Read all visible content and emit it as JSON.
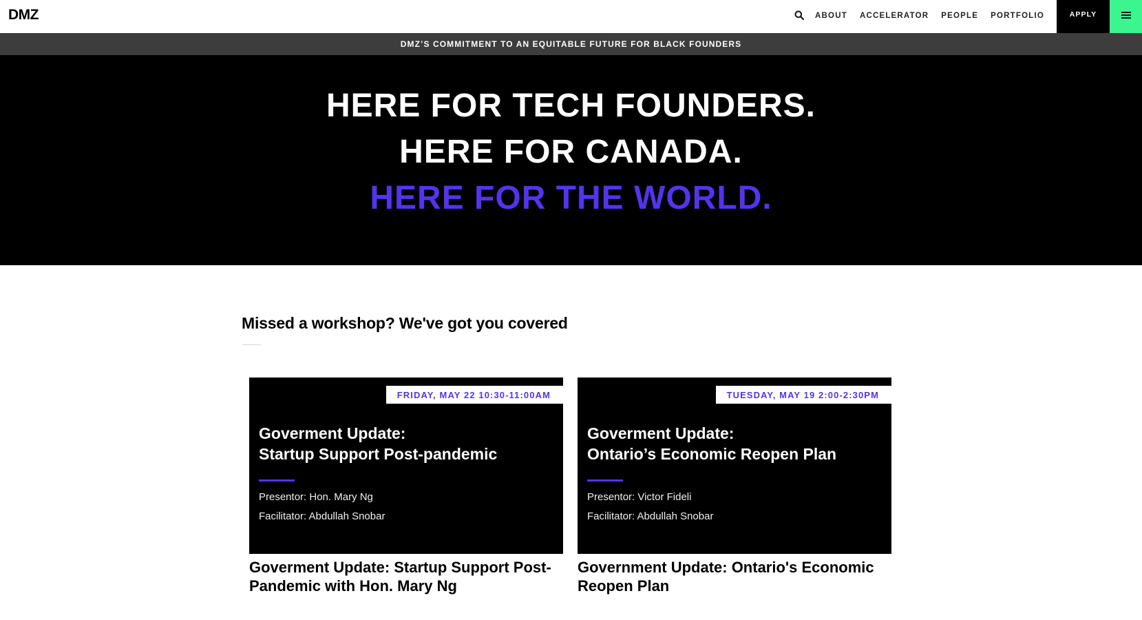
{
  "header": {
    "logo": "DMZ",
    "nav": [
      "ABOUT",
      "ACCELERATOR",
      "PEOPLE",
      "PORTFOLIO"
    ],
    "apply_label": "APPLY",
    "icons": {
      "search": "search-icon",
      "menu": "hamburger-menu-icon"
    },
    "colors": {
      "menu_bg": "#3cf58f",
      "apply_bg": "#000000"
    }
  },
  "announcement": "DMZ’S COMMITMENT TO AN EQUITABLE FUTURE FOR BLACK FOUNDERS",
  "hero": {
    "lines": [
      "HERE FOR TECH FOUNDERS.",
      "HERE FOR CANADA.",
      "HERE FOR THE WORLD."
    ],
    "accent_color": "#5533ee"
  },
  "section": {
    "title": "Missed a workshop? We've got you covered"
  },
  "cards": [
    {
      "badge": "FRIDAY, MAY 22 10:30-11:00AM",
      "thumb_title_1": "Goverment Update:",
      "thumb_title_2": "Startup Support Post-pandemic",
      "presenter": "Presentor: Hon. Mary Ng",
      "facilitator": "Facilitator: Abdullah Snobar",
      "title": "Goverment Update: Startup Support Post-Pandemic with Hon. Mary Ng"
    },
    {
      "badge": "TUESDAY, MAY 19 2:00-2:30PM",
      "thumb_title_1": "Goverment Update:",
      "thumb_title_2": "Ontario’s Economic Reopen Plan",
      "presenter": "Presentor: Victor Fideli",
      "facilitator": "Facilitator: Abdullah Snobar",
      "title": "Government Update: Ontario's Economic Reopen Plan"
    }
  ]
}
